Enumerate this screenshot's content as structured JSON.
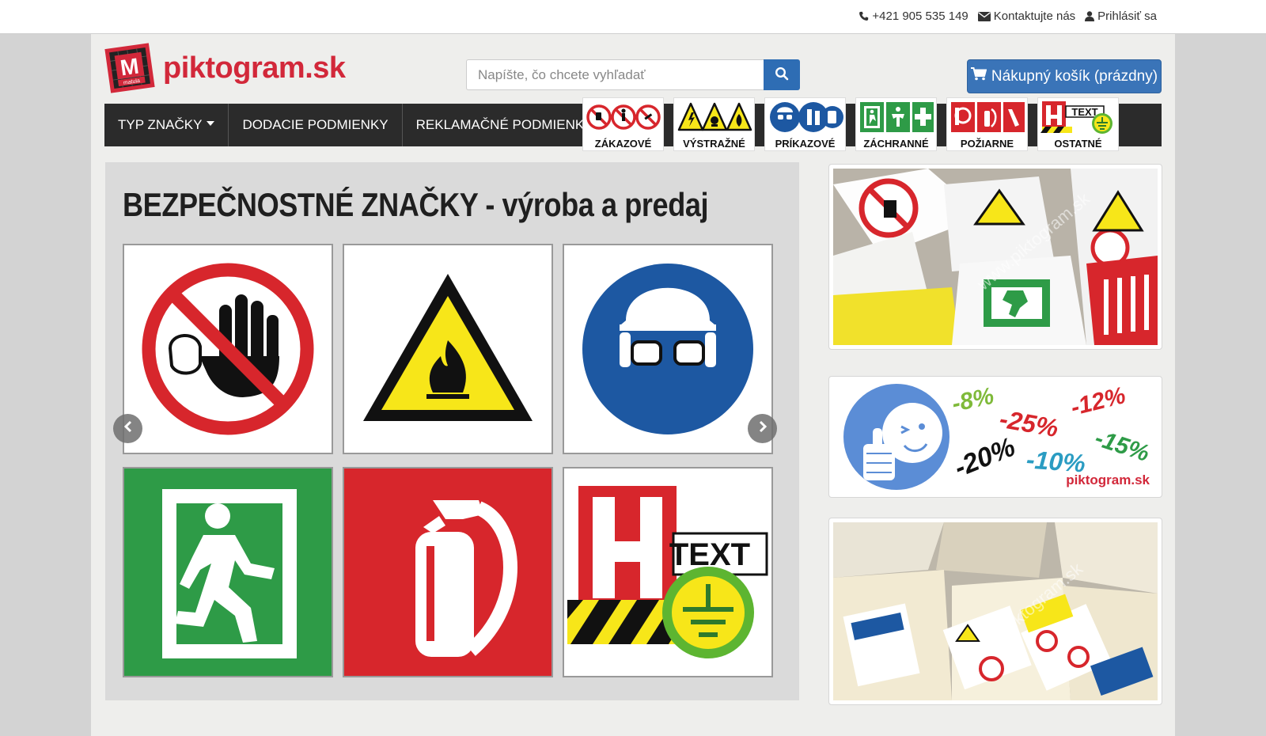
{
  "topbar": {
    "phone": "+421 905 535 149",
    "contact": "Kontaktujte nás",
    "login": "Prihlásiť sa"
  },
  "logo": {
    "mark_letter": "M",
    "mark_sub": "matula",
    "text": "piktogram.sk"
  },
  "search": {
    "placeholder": "Napíšte, čo chcete vyhľadať"
  },
  "cart": {
    "label": "Nákupný košík (prázdny)"
  },
  "nav": {
    "items": [
      {
        "label": "TYP ZNAČKY"
      },
      {
        "label": "DODACIE PODMIENKY"
      },
      {
        "label": "REKLAMAČNÉ PODMIENKY"
      }
    ],
    "categories": [
      {
        "label": "ZÁKAZOVÉ"
      },
      {
        "label": "VÝSTRAŽNÉ"
      },
      {
        "label": "PRÍKAZOVÉ"
      },
      {
        "label": "ZÁCHRANNÉ"
      },
      {
        "label": "POŽIARNE"
      },
      {
        "label": "OSTATNÉ"
      }
    ]
  },
  "carousel": {
    "headline": "BEZPEČNOSTNÉ ZNAČKY - výroba a predaj",
    "tile_text_sign": "TEXT",
    "watermark": "www.piktogram.sk"
  },
  "side": {
    "discounts": [
      "-8%",
      "-25%",
      "-12%",
      "-20%",
      "-10%",
      "-15%"
    ],
    "discount_brand": "piktogram.sk",
    "watermark": "www.piktogram.sk"
  },
  "colors": {
    "brand_red": "#d2283a",
    "nav_bg": "#2b2b2b",
    "button_blue": "#3a74b8",
    "sign_red": "#d7262c",
    "sign_yellow": "#f7e619",
    "sign_blue": "#1d58a2",
    "sign_green": "#2e9b47"
  }
}
